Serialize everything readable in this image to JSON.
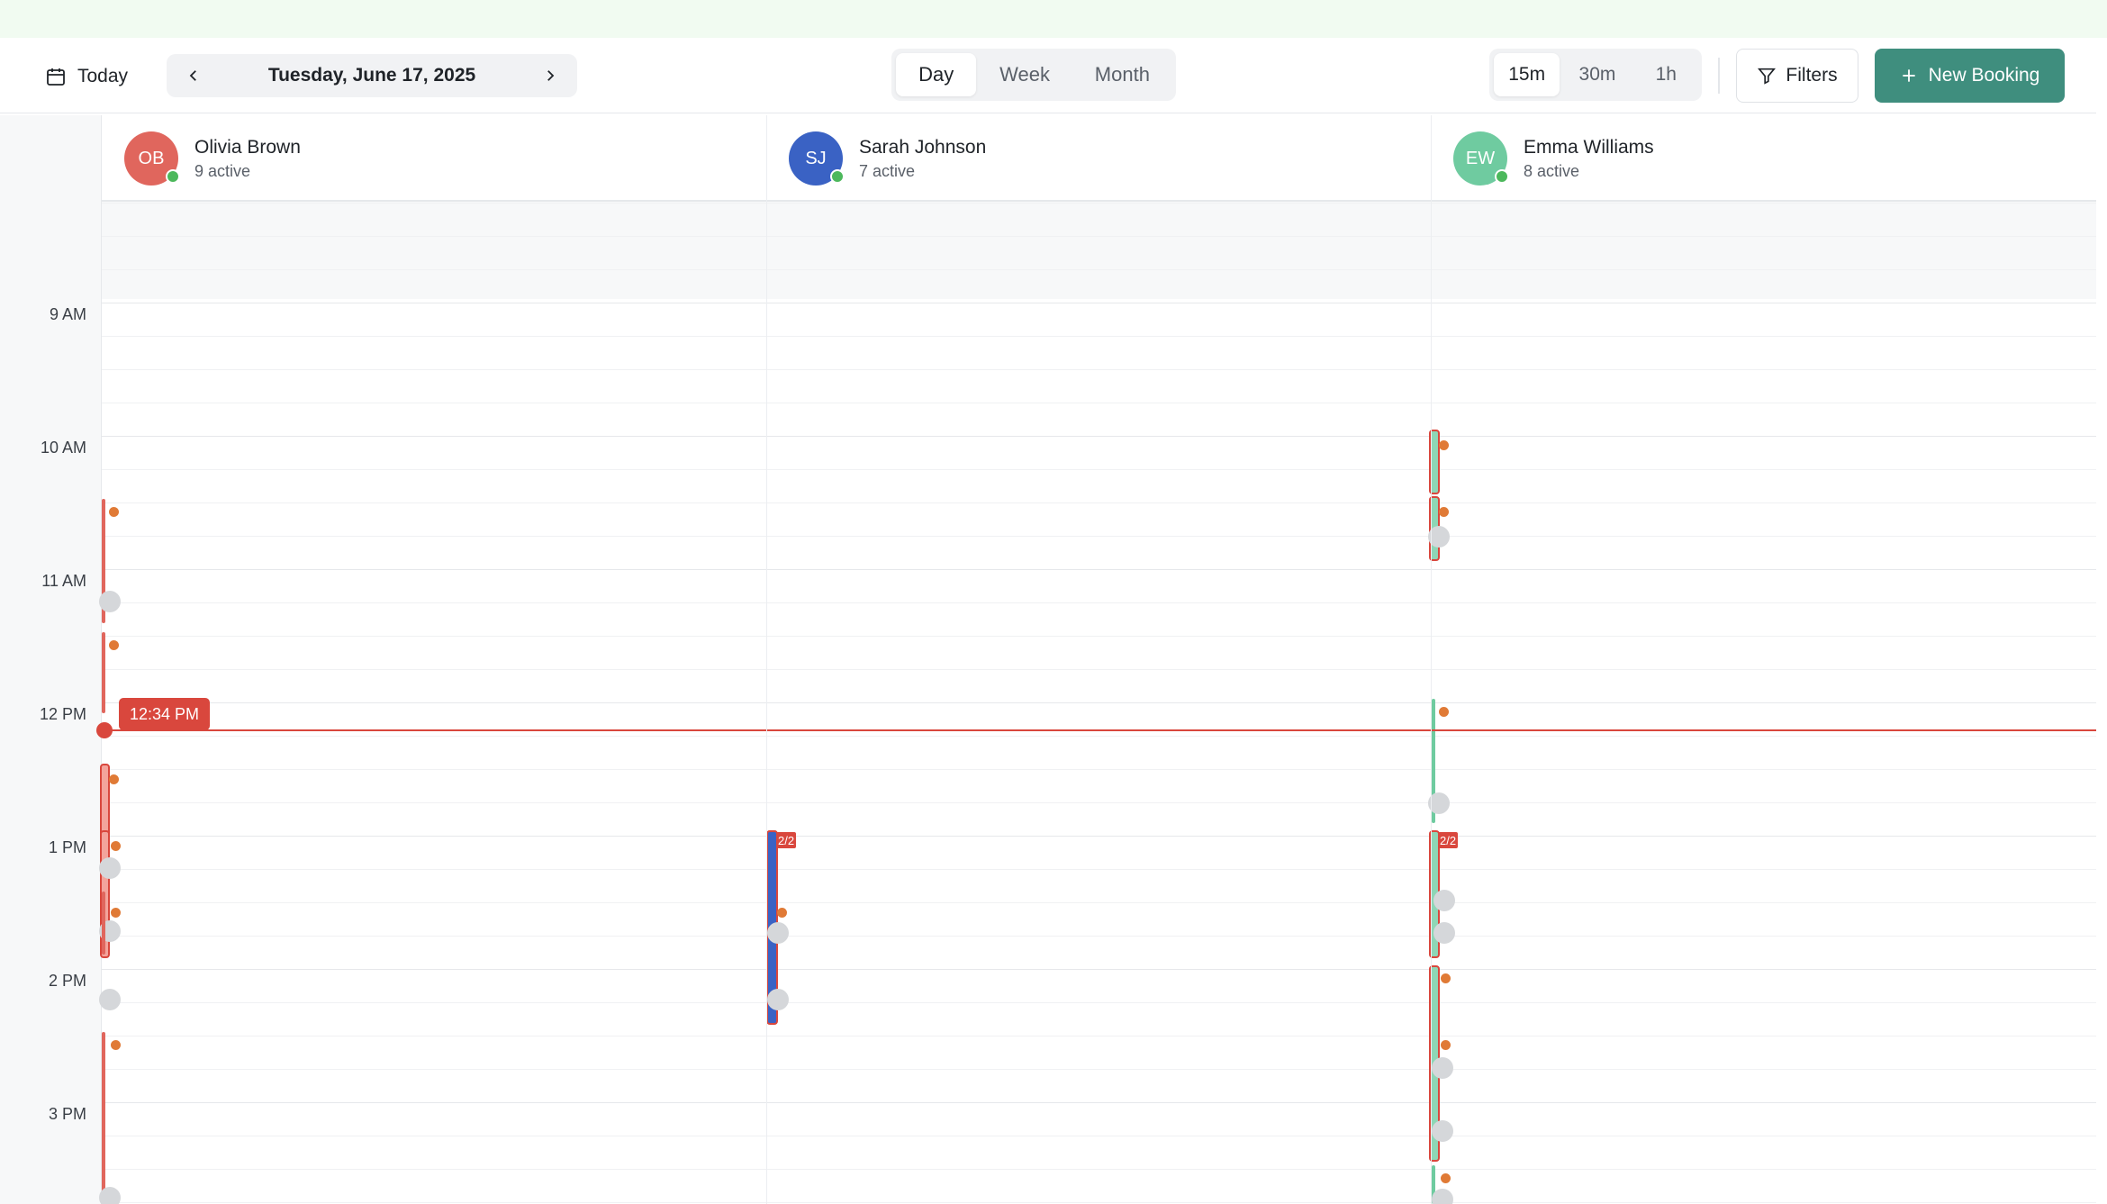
{
  "toolbar": {
    "today_label": "Today",
    "current_date": "Tuesday, June 17, 2025",
    "views": [
      "Day",
      "Week",
      "Month"
    ],
    "active_view": "Day",
    "intervals": [
      "15m",
      "30m",
      "1h"
    ],
    "active_interval": "15m",
    "filters_label": "Filters",
    "new_booking_label": "New Booking"
  },
  "staff": [
    {
      "initials": "OB",
      "name": "Olivia Brown",
      "active": "9 active",
      "color": "#e0665d"
    },
    {
      "initials": "SJ",
      "name": "Sarah Johnson",
      "active": "7 active",
      "color": "#3a62c4"
    },
    {
      "initials": "EW",
      "name": "Emma Williams",
      "active": "8 active",
      "color": "#6fcba0"
    }
  ],
  "time_labels": [
    "9 AM",
    "10 AM",
    "11 AM",
    "12 PM",
    "1 PM",
    "2 PM",
    "3 PM"
  ],
  "now_label": "12:34 PM",
  "badges": {
    "sarah": "2/2",
    "emma": "2/2"
  },
  "colors": {
    "accent": "#3f8e7e",
    "now": "#d9473d",
    "pending": "#e07a36"
  }
}
